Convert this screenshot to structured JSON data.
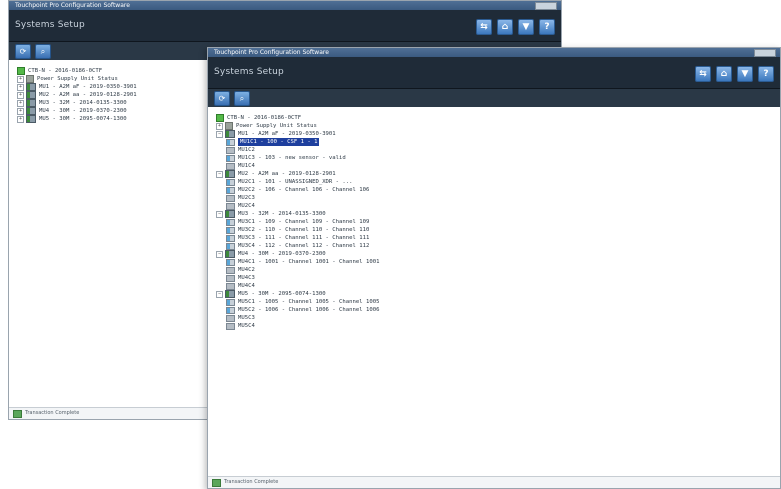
{
  "back_window": {
    "title": "Touchpoint Pro Configuration Software",
    "header_title": "Systems Setup",
    "tree": [
      {
        "label": "CTB-N - 2016-0186-0CTF",
        "kind": "root",
        "indent": 0
      },
      {
        "label": "Power Supply Unit Status",
        "kind": "group",
        "indent": 0
      },
      {
        "label": "MU1 - A2M aF - 2019-0350-3901",
        "kind": "unit",
        "indent": 0
      },
      {
        "label": "MU2 - A2M aa - 2019-0128-2901",
        "kind": "unit",
        "indent": 0
      },
      {
        "label": "MU3 - 32M - 2014-0135-3300",
        "kind": "unit",
        "indent": 0
      },
      {
        "label": "MU4 - 30M - 2019-0370-2300",
        "kind": "unit",
        "indent": 0
      },
      {
        "label": "MU5 - 30M - 2095-0074-1300",
        "kind": "unit",
        "indent": 0
      }
    ],
    "status": "Transaction Complete"
  },
  "front_window": {
    "title": "Touchpoint Pro Configuration Software",
    "header_title": "Systems Setup",
    "tree": [
      {
        "label": "CTB-N - 2016-0186-0CTF",
        "kind": "root",
        "indent": 0
      },
      {
        "label": "Power Supply Unit Status",
        "kind": "group",
        "indent": 0
      },
      {
        "label": "MU1 - A2M aF - 2019-0350-3901",
        "kind": "unit",
        "indent": 0
      },
      {
        "label": "MU1C1 - 100 - CSF 1 - 1",
        "kind": "mod",
        "indent": 1,
        "selected": true
      },
      {
        "label": "MU1C2",
        "kind": "modgray",
        "indent": 1
      },
      {
        "label": "MU1C3 - 103 - new sensor - valid",
        "kind": "mod",
        "indent": 1
      },
      {
        "label": "MU1C4",
        "kind": "modgray",
        "indent": 1
      },
      {
        "label": "MU2 - A2M aa - 2019-0128-2901",
        "kind": "unit",
        "indent": 0
      },
      {
        "label": "MU2C1 - 101 - UNASSIGNED_XDR - ...",
        "kind": "mod",
        "indent": 1
      },
      {
        "label": "MU2C2 - 106 - Channel 106 - Channel 106",
        "kind": "mod",
        "indent": 1
      },
      {
        "label": "MU2C3",
        "kind": "modgray",
        "indent": 1
      },
      {
        "label": "MU2C4",
        "kind": "modgray",
        "indent": 1
      },
      {
        "label": "MU3 - 32M - 2014-0135-3300",
        "kind": "unit",
        "indent": 0
      },
      {
        "label": "MU3C1 - 109 - Channel 109 - Channel 109",
        "kind": "mod",
        "indent": 1
      },
      {
        "label": "MU3C2 - 110 - Channel 110 - Channel 110",
        "kind": "mod",
        "indent": 1
      },
      {
        "label": "MU3C3 - 111 - Channel 111 - Channel 111",
        "kind": "mod",
        "indent": 1
      },
      {
        "label": "MU3C4 - 112 - Channel 112 - Channel 112",
        "kind": "mod",
        "indent": 1
      },
      {
        "label": "MU4 - 30M - 2019-0370-2300",
        "kind": "unit",
        "indent": 0
      },
      {
        "label": "MU4C1 - 1001 - Channel 1001 - Channel 1001",
        "kind": "mod",
        "indent": 1
      },
      {
        "label": "MU4C2",
        "kind": "modgray",
        "indent": 1
      },
      {
        "label": "MU4C3",
        "kind": "modgray",
        "indent": 1
      },
      {
        "label": "MU4C4",
        "kind": "modgray",
        "indent": 1
      },
      {
        "label": "MU5 - 30M - 2095-0074-1300",
        "kind": "unit",
        "indent": 0
      },
      {
        "label": "MU5C1 - 1005 - Channel 1005 - Channel 1005",
        "kind": "mod",
        "indent": 1
      },
      {
        "label": "MU5C2 - 1006 - Channel 1006 - Channel 1006",
        "kind": "mod",
        "indent": 1
      },
      {
        "label": "MU5C3",
        "kind": "modgray",
        "indent": 1
      },
      {
        "label": "MU5C4",
        "kind": "modgray",
        "indent": 1
      }
    ],
    "status": "Transaction Complete"
  },
  "header_icons": [
    {
      "name": "network-icon",
      "glyph": "⇆"
    },
    {
      "name": "home-icon",
      "glyph": "⌂"
    },
    {
      "name": "filter-icon",
      "glyph": "▼"
    },
    {
      "name": "help-icon",
      "glyph": "?"
    }
  ],
  "toolbar_icons": [
    {
      "name": "refresh-icon",
      "glyph": "⟳"
    },
    {
      "name": "search-icon",
      "glyph": "⌕"
    }
  ],
  "colors": {
    "header_bg": "#1f2b38",
    "selection": "#1e3f9e",
    "status_ok": "#54b948"
  }
}
